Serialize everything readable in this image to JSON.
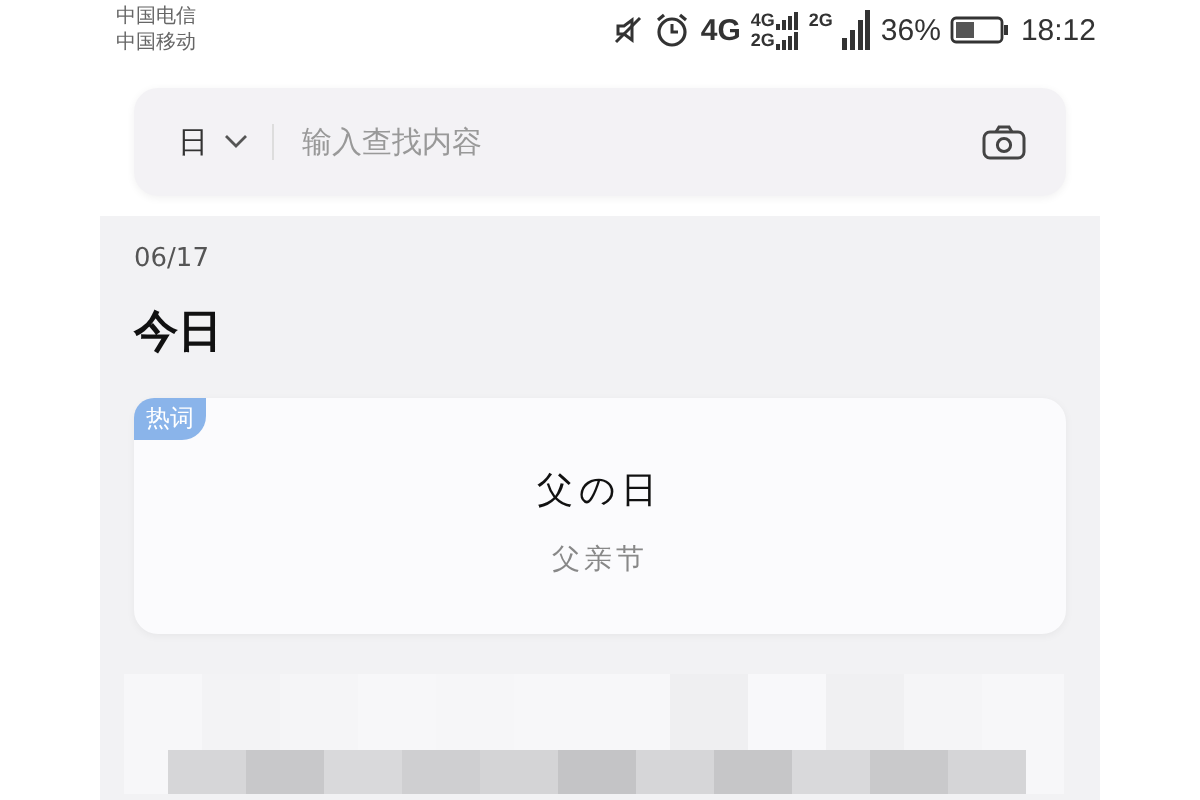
{
  "status_bar": {
    "carriers": [
      "中国电信",
      "中国移动"
    ],
    "network": "4G",
    "sim_networks": [
      "4G",
      "2G"
    ],
    "network_2": "2G",
    "battery": "36%",
    "time": "18:12"
  },
  "search": {
    "scope": "日",
    "placeholder": "输入查找内容"
  },
  "date": "06/17",
  "heading": "今日",
  "hot_card": {
    "badge": "热词",
    "title": "父の日",
    "subtitle": "父亲节"
  }
}
